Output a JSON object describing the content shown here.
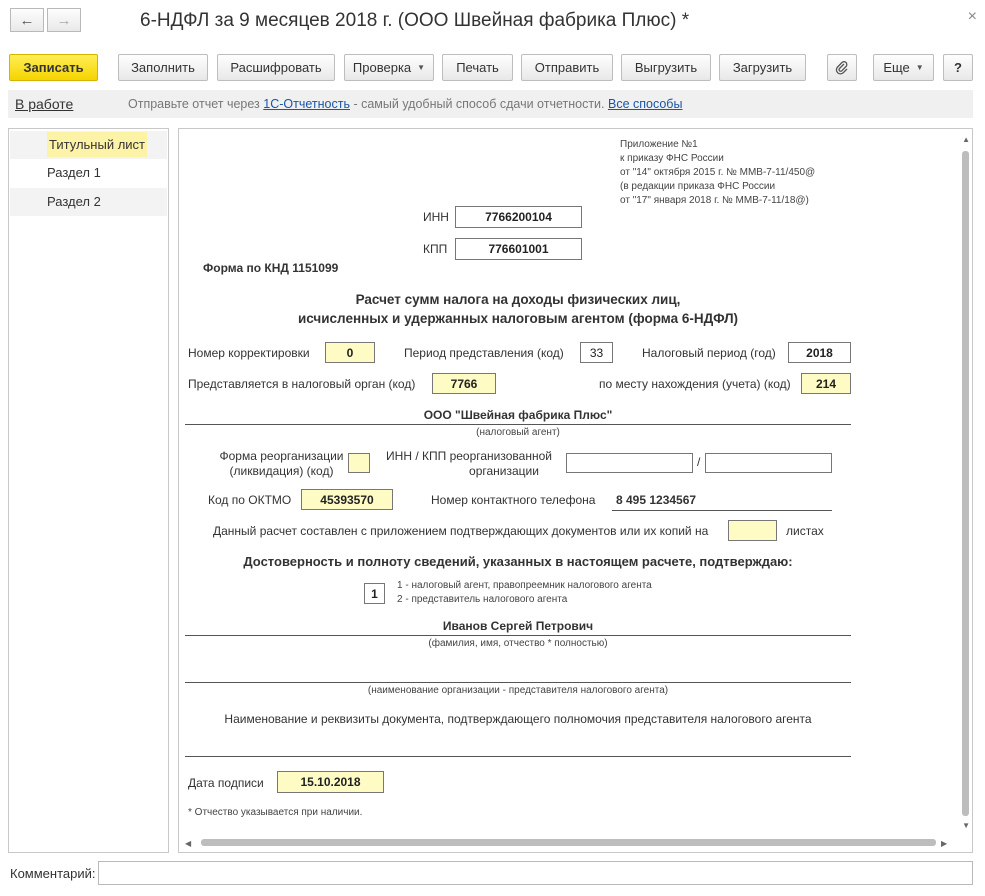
{
  "window": {
    "title": "6-НДФЛ за 9 месяцев 2018 г. (ООО Швейная фабрика Плюс) *",
    "back_icon": "←",
    "forward_icon": "→",
    "close_icon": "×"
  },
  "toolbar": {
    "save": "Записать",
    "fill": "Заполнить",
    "decode": "Расшифровать",
    "check": "Проверка",
    "print": "Печать",
    "send": "Отправить",
    "upload": "Выгрузить",
    "load": "Загрузить",
    "more": "Еще",
    "help": "?"
  },
  "infobar": {
    "status": "В работе",
    "msg_prefix": "Отправьте отчет через ",
    "msg_link": "1С-Отчетность",
    "msg_suffix": " - самый удобный способ сдачи отчетности. ",
    "all_methods": "Все способы"
  },
  "sidebar": {
    "items": [
      {
        "label": "Титульный лист"
      },
      {
        "label": "Раздел 1"
      },
      {
        "label": "Раздел 2"
      }
    ]
  },
  "form": {
    "appendix": [
      "Приложение №1",
      "к приказу ФНС России",
      "от \"14\" октября 2015 г. № ММВ-7-11/450@",
      "(в редакции приказа ФНС России",
      "от \"17\" января 2018 г. № ММВ-7-11/18@)"
    ],
    "inn_label": "ИНН",
    "inn": "7766200104",
    "kpp_label": "КПП",
    "kpp": "776601001",
    "knd": "Форма по КНД 1151099",
    "heading1": "Расчет сумм налога на доходы физических лиц,",
    "heading2": "исчисленных и удержанных налоговым агентом (форма 6-НДФЛ)",
    "correction_label": "Номер корректировки",
    "correction": "0",
    "period_label": "Период представления (код)",
    "period": "33",
    "tax_period_label": "Налоговый период (год)",
    "tax_period": "2018",
    "tax_authority_label": "Представляется в налоговый орган (код)",
    "tax_authority": "7766",
    "location_label": "по месту нахождения (учета) (код)",
    "location": "214",
    "org_name": "ООО \"Швейная фабрика Плюс\"",
    "org_caption": "(налоговый агент)",
    "reorg_form_label1": "Форма реорганизации",
    "reorg_form_label2": "(ликвидация) (код)",
    "reorg_inn_label1": "ИНН / КПП реорганизованной",
    "reorg_inn_label2": "организации",
    "slash": "/",
    "oktmo_label": "Код по ОКТМО",
    "oktmo": "45393570",
    "phone_label": "Номер контактного телефона",
    "phone": "8 495 1234567",
    "attachments_label": "Данный расчет составлен с приложением подтверждающих документов или их копий на",
    "sheets_label": "листах",
    "confirm": "Достоверность и полноту сведений, указанных в настоящем расчете, подтверждаю:",
    "signer_code": "1",
    "signer_opt1": "1 - налоговый агент, правопреемник налогового агента",
    "signer_opt2": "2 - представитель налогового агента",
    "signer_name": "Иванов Сергей Петрович",
    "fio_caption": "(фамилия, имя, отчество * полностью)",
    "org_rep_caption": "(наименование организации - представителя налогового агента)",
    "doc_label": "Наименование и реквизиты документа, подтверждающего полномочия представителя налогового агента",
    "sign_date_label": "Дата подписи",
    "sign_date": "15.10.2018",
    "footnote": "* Отчество указывается при наличии."
  },
  "comment_label": "Комментарий:"
}
